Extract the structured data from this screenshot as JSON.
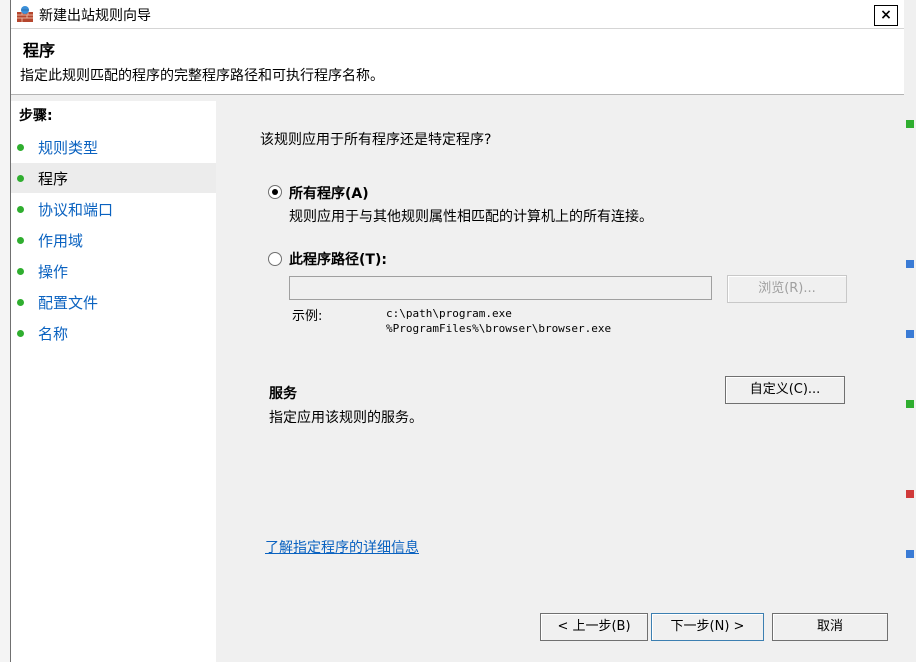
{
  "window": {
    "title": "新建出站规则向导",
    "close": "×"
  },
  "header": {
    "title": "程序",
    "description": "指定此规则匹配的程序的完整程序路径和可执行程序名称。"
  },
  "steps": {
    "title": "步骤:",
    "items": [
      {
        "label": "规则类型",
        "active": false
      },
      {
        "label": "程序",
        "active": true
      },
      {
        "label": "协议和端口",
        "active": false
      },
      {
        "label": "作用域",
        "active": false
      },
      {
        "label": "操作",
        "active": false
      },
      {
        "label": "配置文件",
        "active": false
      },
      {
        "label": "名称",
        "active": false
      }
    ]
  },
  "main": {
    "question": "该规则应用于所有程序还是特定程序?",
    "all_programs": {
      "label": "所有程序(A)",
      "description": "规则应用于与其他规则属性相匹配的计算机上的所有连接。",
      "checked": true
    },
    "program_path": {
      "label": "此程序路径(T):",
      "value": "",
      "checked": false
    },
    "browse_label": "浏览(R)...",
    "example": {
      "label": "示例:",
      "line1": "c:\\path\\program.exe",
      "line2": "%ProgramFiles%\\browser\\browser.exe"
    },
    "services": {
      "title": "服务",
      "description": "指定应用该规则的服务。",
      "customize_label": "自定义(C)..."
    },
    "learn_more": "了解指定程序的详细信息"
  },
  "footer": {
    "back": "< 上一步(B)",
    "next": "下一步(N) >",
    "cancel": "取消"
  },
  "colors": {
    "link": "#0a62c0",
    "step_dot": "#2fae2f"
  }
}
